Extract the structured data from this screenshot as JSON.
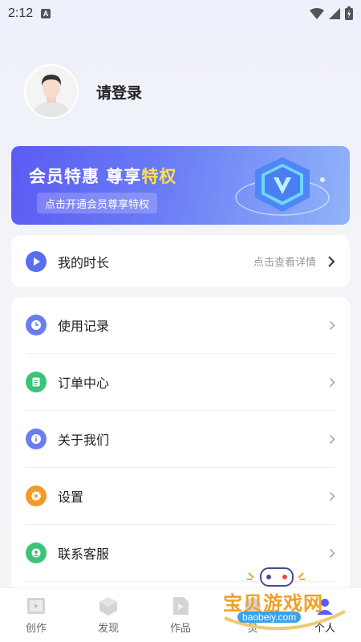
{
  "status_bar": {
    "time": "2:12",
    "a_badge": "A"
  },
  "profile": {
    "login_label": "请登录"
  },
  "vip": {
    "title_main": "会员特惠 尊享",
    "title_highlight": "特权",
    "subtitle": "点击开通会员尊享特权"
  },
  "time_card": {
    "label": "我的时长",
    "hint": "点击查看详情"
  },
  "menu": [
    {
      "label": "使用记录",
      "icon": "clock-icon",
      "color": "#6a7df0"
    },
    {
      "label": "订单中心",
      "icon": "order-icon",
      "color": "#3cc37a"
    },
    {
      "label": "关于我们",
      "icon": "info-icon",
      "color": "#6a7df0"
    },
    {
      "label": "设置",
      "icon": "gear-icon",
      "color": "#f59a2a"
    },
    {
      "label": "联系客服",
      "icon": "customer-service-icon",
      "color": "#3cc37a"
    }
  ],
  "bottom_nav": [
    {
      "label": "创作",
      "icon": "film-icon"
    },
    {
      "label": "发现",
      "icon": "cube-icon"
    },
    {
      "label": "作品",
      "icon": "video-file-icon"
    },
    {
      "label": "灵",
      "icon": "spark-icon"
    },
    {
      "label": "个人",
      "icon": "person-icon"
    }
  ],
  "watermark": {
    "text": "宝贝游戏网",
    "url": "baobeiy.com"
  },
  "colors": {
    "accent": "#5b5cf3",
    "highlight": "#ffe04a"
  }
}
